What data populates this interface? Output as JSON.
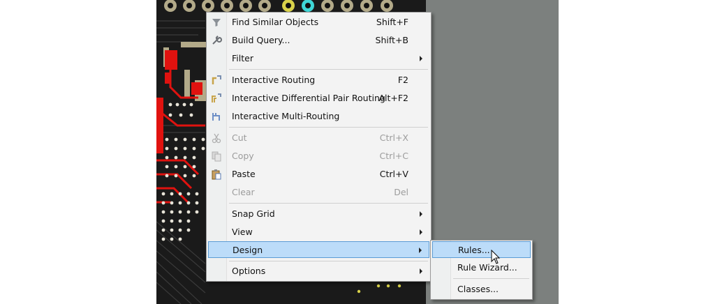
{
  "context_menu": {
    "items": [
      {
        "label": "Find Similar Objects",
        "shortcut": "Shift+F",
        "icon": "funnel-icon"
      },
      {
        "label": "Build Query...",
        "shortcut": "Shift+B",
        "icon": "wrench-icon"
      },
      {
        "label": "Filter",
        "shortcut": "",
        "submenu": true
      },
      {
        "label": "Interactive Routing",
        "shortcut": "F2",
        "icon": "route-icon"
      },
      {
        "label": "Interactive Differential Pair Routing",
        "shortcut": "Alt+F2",
        "icon": "diff-pair-route-icon"
      },
      {
        "label": "Interactive Multi-Routing",
        "shortcut": "",
        "icon": "multi-route-icon"
      },
      {
        "label": "Cut",
        "shortcut": "Ctrl+X",
        "disabled": true,
        "icon": "scissors-icon"
      },
      {
        "label": "Copy",
        "shortcut": "Ctrl+C",
        "disabled": true,
        "icon": "copy-icon"
      },
      {
        "label": "Paste",
        "shortcut": "Ctrl+V",
        "icon": "paste-icon"
      },
      {
        "label": "Clear",
        "shortcut": "Del",
        "disabled": true
      },
      {
        "label": "Snap Grid",
        "submenu": true
      },
      {
        "label": "View",
        "submenu": true
      },
      {
        "label": "Design",
        "submenu": true,
        "highlighted": true
      },
      {
        "label": "Options",
        "submenu": true
      }
    ]
  },
  "design_submenu": {
    "items": [
      {
        "label": "Rules...",
        "highlighted": true
      },
      {
        "label": "Rule Wizard..."
      },
      {
        "label": "Classes..."
      }
    ]
  },
  "colors": {
    "highlight_bg": "#bcdcf9",
    "highlight_border": "#5a9bd5",
    "pcb_background": "#1a1a1a",
    "copper_red": "#e0120f",
    "silk_tan": "#b3aa89",
    "side_panel": "#7c807e"
  }
}
